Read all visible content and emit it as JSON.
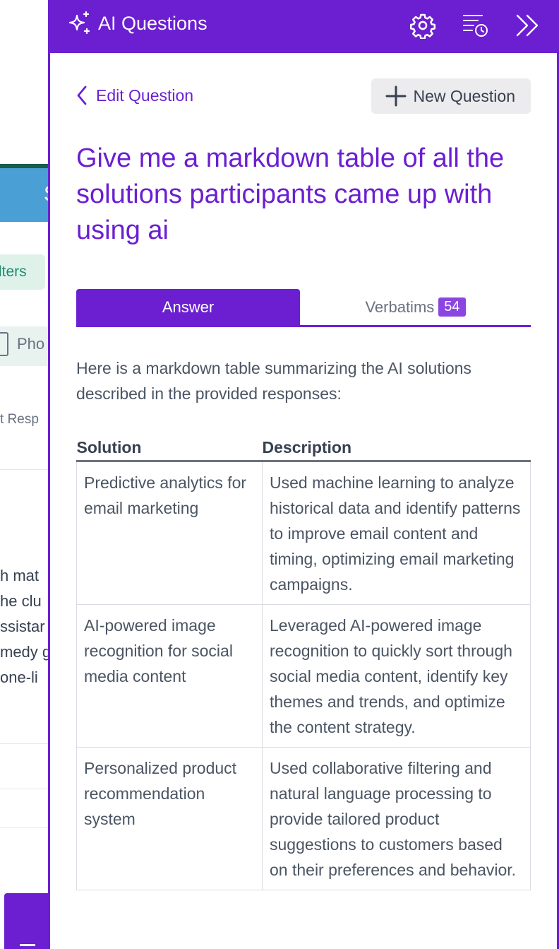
{
  "background_app": {
    "header_letter": "S",
    "filters_label": "lters",
    "photo_label": "Pho",
    "responses_label": "t Resp",
    "paragraph_lines": [
      "h mat",
      "he clu",
      "ssistar",
      "medy g",
      "one-li"
    ]
  },
  "panel": {
    "title": "AI Questions",
    "icons": {
      "sparkle": "sparkle-icon",
      "settings": "gear-icon",
      "history": "history-icon",
      "collapse": "double-chevron-right-icon"
    },
    "accent_color": "#6b1fd1"
  },
  "nav": {
    "back_label": "Edit Question",
    "new_question_label": "New Question"
  },
  "question": "Give me a markdown table of all the solutions participants came up with using ai",
  "tabs": {
    "answer_label": "Answer",
    "verbatims_label": "Verbatims",
    "verbatims_count": "54"
  },
  "answer": {
    "intro": "Here is a markdown table summarizing the AI solutions described in the provided responses:",
    "table": {
      "headers": [
        "Solution",
        "Description"
      ],
      "rows": [
        {
          "solution": "Predictive analytics for email marketing",
          "description": "Used machine learning to analyze historical data and identify patterns to improve email content and timing, optimizing email marketing campaigns."
        },
        {
          "solution": "AI-powered image recognition for social media content",
          "description": "Leveraged AI-powered image recognition to quickly sort through social media content, identify key themes and trends, and optimize the content strategy."
        },
        {
          "solution": "Personalized product recommendation system",
          "description": "Used collaborative filtering and natural language processing to provide tailored product suggestions to customers based on their preferences and behavior."
        }
      ]
    }
  }
}
